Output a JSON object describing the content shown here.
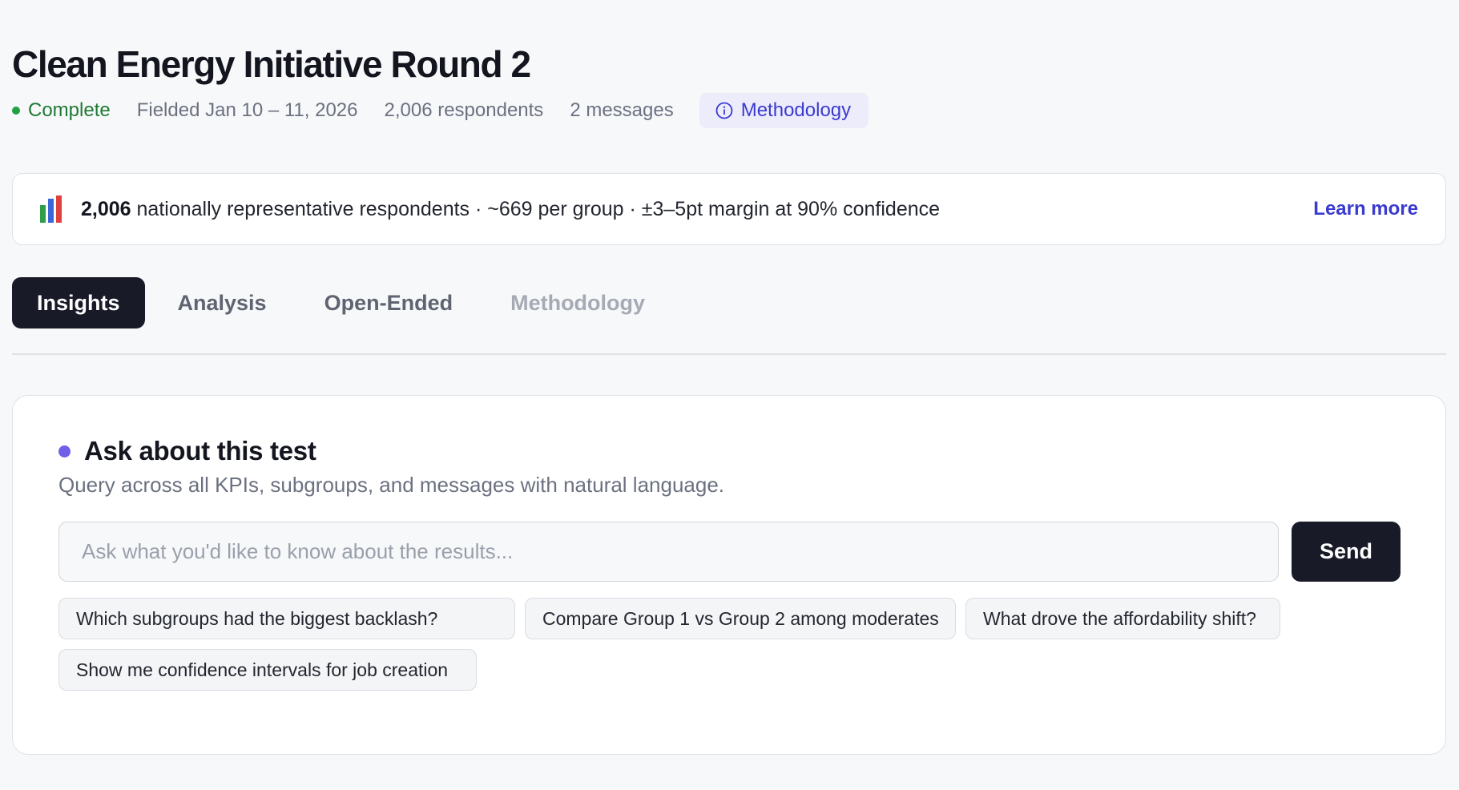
{
  "header": {
    "title": "Clean Energy Initiative Round 2",
    "status": "Complete",
    "fielded": "Fielded Jan 10 – 11, 2026",
    "respondents": "2,006 respondents",
    "messages": "2 messages",
    "methodology_chip": "Methodology",
    "methodology_icon": "info-icon"
  },
  "banner": {
    "icon": "bar-chart-icon",
    "count": "2,006",
    "text": " nationally representative respondents · ~669 per group · ±3–5pt margin at 90% confidence",
    "link": "Learn more"
  },
  "tabs": [
    {
      "label": "Insights",
      "active": true
    },
    {
      "label": "Analysis",
      "active": false
    },
    {
      "label": "Open-Ended",
      "active": false
    },
    {
      "label": "Methodology",
      "active": false
    }
  ],
  "ask": {
    "title": "Ask about this test",
    "subtitle": "Query across all KPIs, subgroups, and messages with natural language.",
    "input_value": "",
    "input_placeholder": "Ask what you'd like to know about the results...",
    "send_label": "Send",
    "suggestions": [
      "Which subgroups had the biggest backlash?",
      "Compare Group 1 vs Group 2 among moderates",
      "What drove the affordability shift?",
      "Show me confidence intervals for job creation"
    ]
  },
  "colors": {
    "status_green": "#22a042",
    "accent_purple": "#3b3ad0",
    "dark_button": "#181a28",
    "ask_dot": "#7060e8"
  }
}
